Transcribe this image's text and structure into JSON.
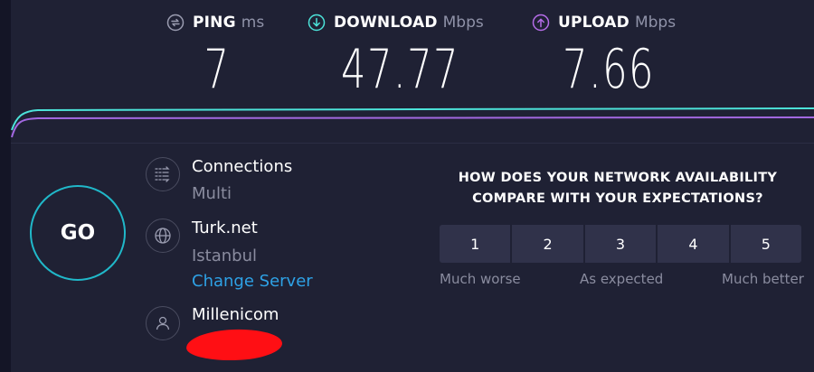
{
  "metrics": {
    "ping": {
      "name": "PING",
      "unit": "ms",
      "value": "7",
      "icon": "ping-icon",
      "color": "#8a8c9f"
    },
    "download": {
      "name": "DOWNLOAD",
      "unit": "Mbps",
      "value": "47.77",
      "icon": "download-arrow-icon",
      "color": "#4ce3d9"
    },
    "upload": {
      "name": "UPLOAD",
      "unit": "Mbps",
      "value": "7.66",
      "icon": "upload-arrow-icon",
      "color": "#b56ce8"
    }
  },
  "colors": {
    "accent_cyan": "#20b8c9",
    "link_blue": "#2ea2e6",
    "redaction": "#ff0f14",
    "background": "#1f2134"
  },
  "go_button": {
    "label": "GO"
  },
  "connections": {
    "title": "Connections",
    "value": "Multi",
    "icon": "connections-icon"
  },
  "server": {
    "title": "Turk.net",
    "location": "Istanbul",
    "change_link": "Change Server",
    "icon": "globe-icon"
  },
  "provider": {
    "title": "Millenicom",
    "icon": "user-icon"
  },
  "survey": {
    "question_line1": "HOW DOES YOUR NETWORK AVAILABILITY",
    "question_line2": "COMPARE WITH YOUR EXPECTATIONS?",
    "options": [
      "1",
      "2",
      "3",
      "4",
      "5"
    ],
    "label_low": "Much worse",
    "label_mid": "As expected",
    "label_high": "Much better"
  }
}
